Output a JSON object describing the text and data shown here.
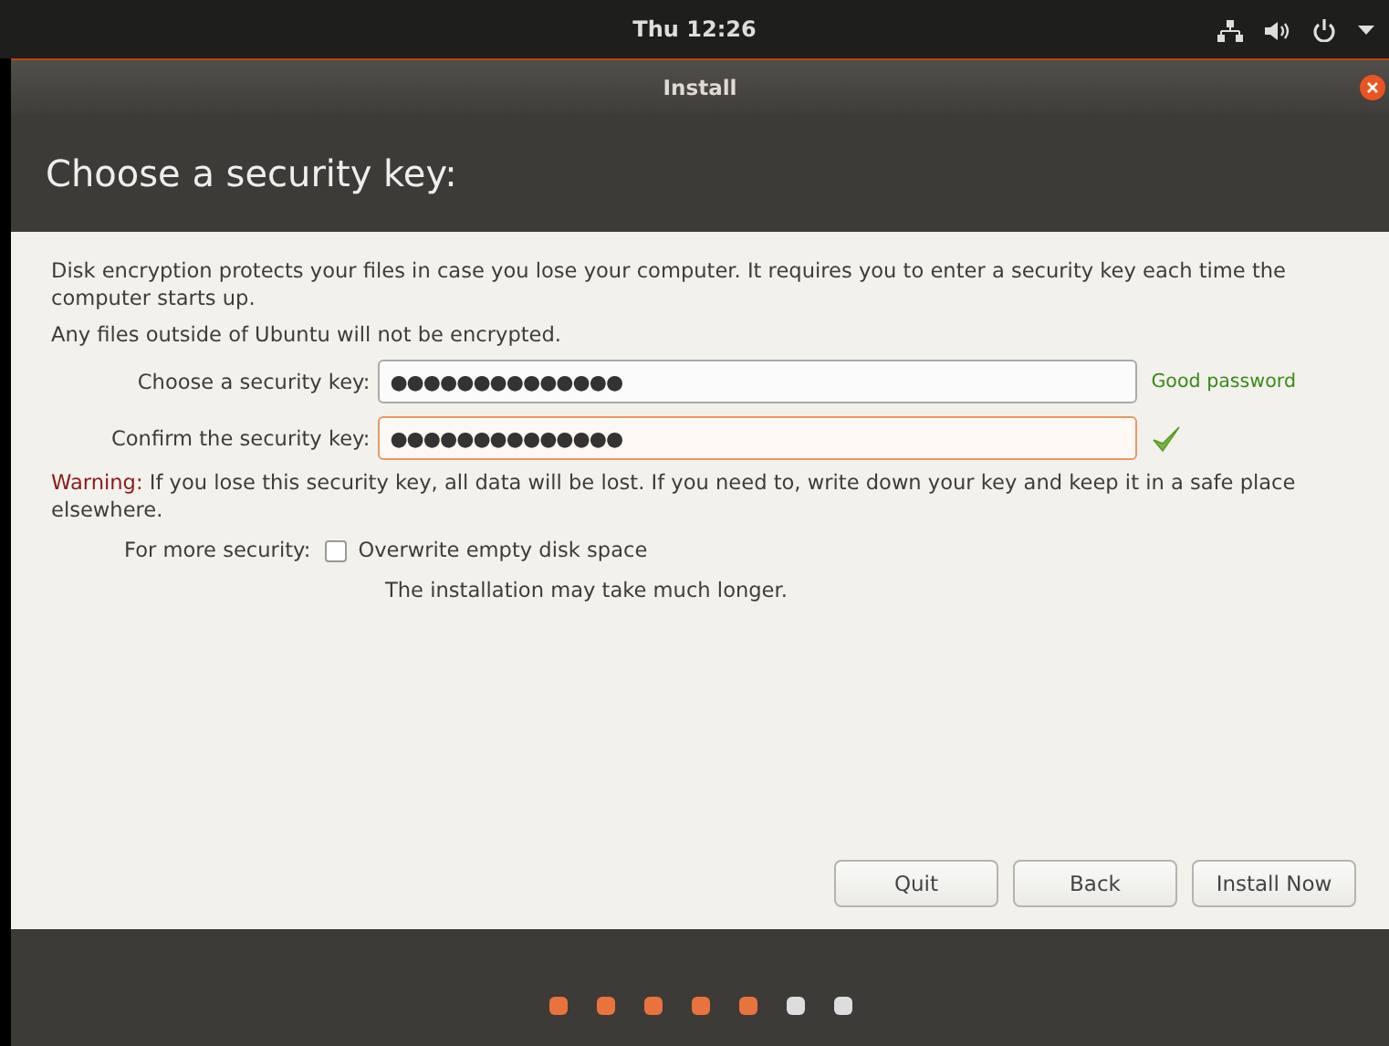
{
  "top_panel": {
    "clock": "Thu 12:26"
  },
  "window": {
    "title": "Install"
  },
  "header": {
    "title": "Choose a security key:"
  },
  "intro": [
    "Disk encryption protects your files in case you lose your computer. It requires you to enter a security key each time the computer starts up.",
    "Any files outside of Ubuntu will not be encrypted."
  ],
  "fields": [
    {
      "label": "Choose a security key:",
      "value": "●●●●●●●●●●●●●●",
      "focused": false,
      "status": "Good password"
    },
    {
      "label": "Confirm the security key:",
      "value": "●●●●●●●●●●●●●●",
      "focused": true,
      "matches": true
    }
  ],
  "warning": {
    "prefix": "Warning:",
    "text": "If you lose this security key, all data will be lost. If you need to, write down your key and keep it in a safe place elsewhere."
  },
  "security": {
    "label": "For more security:",
    "option": "Overwrite empty disk space",
    "checked": false,
    "note": "The installation may take much longer."
  },
  "buttons": [
    "Quit",
    "Back",
    "Install Now"
  ],
  "progress": [
    {
      "done": true
    },
    {
      "done": true
    },
    {
      "done": true
    },
    {
      "done": true
    },
    {
      "done": true
    },
    {
      "done": false
    },
    {
      "done": false
    }
  ]
}
